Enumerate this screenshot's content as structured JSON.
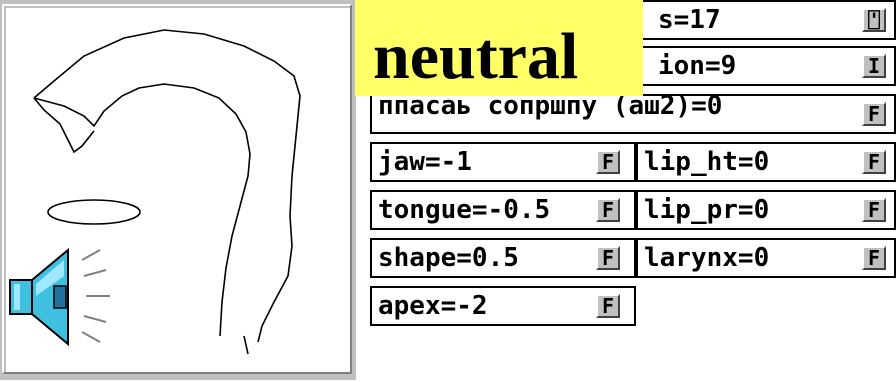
{
  "overlay_label": "neutral",
  "icons": {
    "speaker": "speaker-icon",
    "toggle_alt": "toggle-button-icon",
    "toggle_i": "i-button-icon"
  },
  "colors": {
    "overlay_bg": "#ffff66",
    "button_face": "#c0c0c0",
    "speaker_fill": "#40c0e0"
  },
  "params_partial": [
    {
      "label": "s=17",
      "button": "⍞"
    },
    {
      "label": "ion=9",
      "button": "I"
    },
    {
      "label": "ппасаь сопршпу (аш2)=0",
      "button": "F"
    }
  ],
  "params_left": [
    {
      "label": "jaw=-1",
      "button": "F"
    },
    {
      "label": "tongue=-0.5",
      "button": "F"
    },
    {
      "label": "shape=0.5",
      "button": "F"
    },
    {
      "label": "apex=-2",
      "button": "F"
    }
  ],
  "params_right": [
    {
      "label": "lip_ht=0",
      "button": "F"
    },
    {
      "label": "lip_pr=0",
      "button": "F"
    },
    {
      "label": "larynx=0",
      "button": "F"
    }
  ]
}
